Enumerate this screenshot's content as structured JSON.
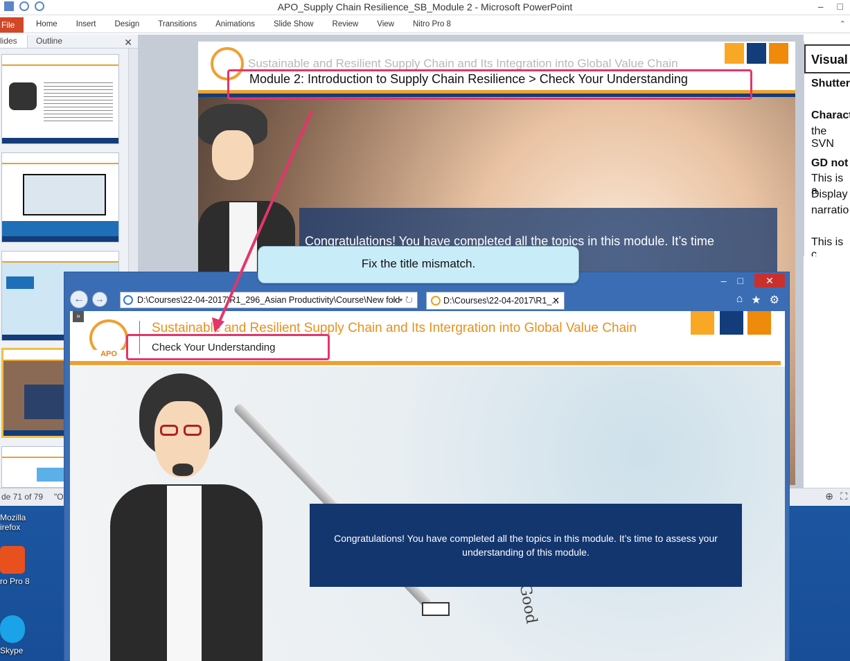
{
  "ppt": {
    "window_title": "APO_Supply Chain Resilience_SB_Module 2  -  Microsoft PowerPoint",
    "tabs": [
      "File",
      "Home",
      "Insert",
      "Design",
      "Transitions",
      "Animations",
      "Slide Show",
      "Review",
      "View",
      "Nitro Pro 8"
    ],
    "slide_pane_tabs": [
      "lides",
      "Outline"
    ],
    "status_slide": "de 71 of 79",
    "status_theme": "\"Off",
    "slide": {
      "header_title": "Sustainable and Resilient Supply Chain and Its Integration into Global Value Chain",
      "module_title": "Module 2: Introduction to Supply Chain Resilience > Check Your Understanding",
      "box_text": "Congratulations! You have completed all the topics in this module. It’s time"
    },
    "notes": {
      "heading": "Visual",
      "lines": [
        "Shutter",
        "Charact",
        "the SVN",
        "GD not",
        "This is a",
        "Display",
        "narratio",
        "This is c"
      ]
    }
  },
  "desktop_icons": [
    {
      "label": "Mozilla\nFirefox",
      "icon": "firefox-icon"
    },
    {
      "label": "ro Pro 8",
      "icon": "nitro-icon"
    },
    {
      "label": "Skype",
      "icon": "skype-icon"
    }
  ],
  "callout": "Fix the title mismatch.",
  "browser": {
    "address": "D:\\Courses\\22-04-2017\\R1_296_Asian Productivity\\Course\\New fold",
    "tab_title": "D:\\Courses\\22-04-2017\\R1_...",
    "page": {
      "logo_text": "APO",
      "title": "Sustainable and Resilient Supply Chain and Its Intergration into Global Value Chain",
      "subtitle": "Check Your Understanding",
      "message": "Congratulations! You have completed all the topics in this module. It’s time to assess your understanding of this module.",
      "paper_text": "Good"
    }
  },
  "colors": {
    "accent_orange": "#f0a030",
    "navy": "#13366f",
    "highlight": "#e4356a",
    "square_1": "#f9a825",
    "square_2": "#123c7a",
    "square_3": "#ef8a0a"
  }
}
